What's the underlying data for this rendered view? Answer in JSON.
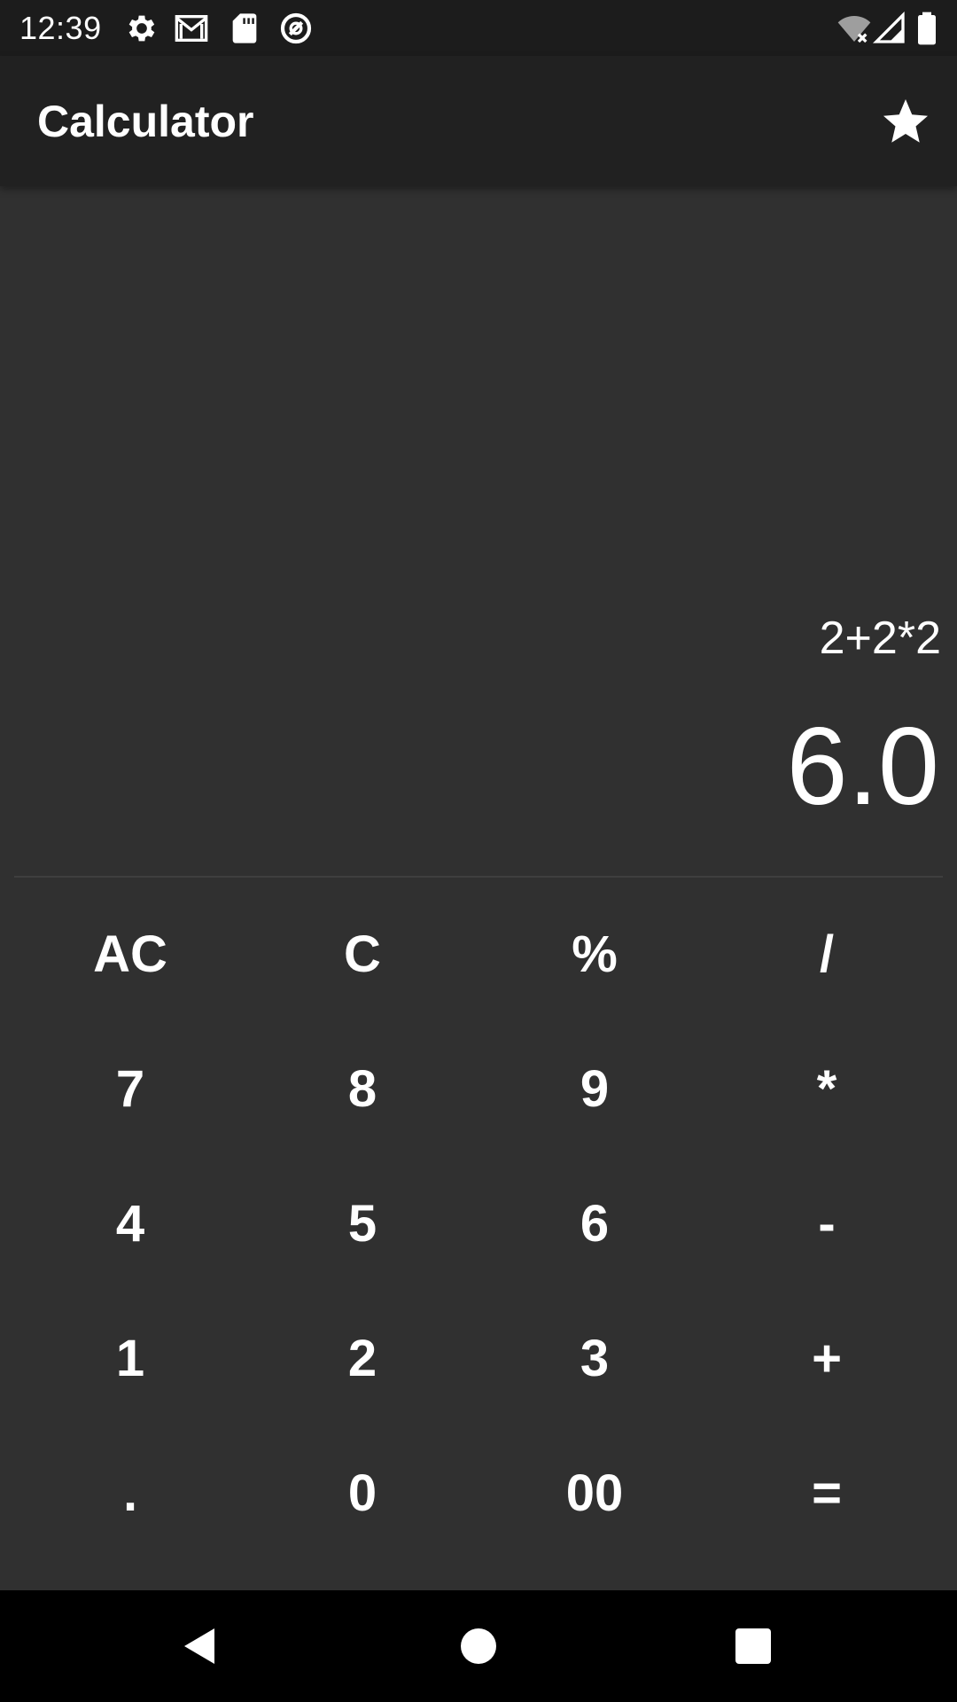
{
  "status_bar": {
    "time": "12:39",
    "icons_left": [
      "gear-icon",
      "gmail-icon",
      "sd-card-icon",
      "at-sign-icon"
    ],
    "icons_right": [
      "wifi-off-icon",
      "signal-icon",
      "battery-icon"
    ]
  },
  "app_bar": {
    "title": "Calculator",
    "action_icon": "star-icon"
  },
  "display": {
    "expression": "2+2*2",
    "result": "6.0"
  },
  "keypad": {
    "rows": [
      [
        "AC",
        "C",
        "%",
        "/"
      ],
      [
        "7",
        "8",
        "9",
        "*"
      ],
      [
        "4",
        "5",
        "6",
        "-"
      ],
      [
        "1",
        "2",
        "3",
        "+"
      ],
      [
        ".",
        "0",
        "00",
        "="
      ]
    ]
  },
  "nav_bar": {
    "icons": [
      "back-icon",
      "home-icon",
      "recents-icon"
    ]
  },
  "colors": {
    "status_bar_bg": "#1c1c1c",
    "app_bar_bg": "#212121",
    "body_bg": "#303030",
    "text": "#ffffff",
    "nav_bar_bg": "#000000"
  }
}
